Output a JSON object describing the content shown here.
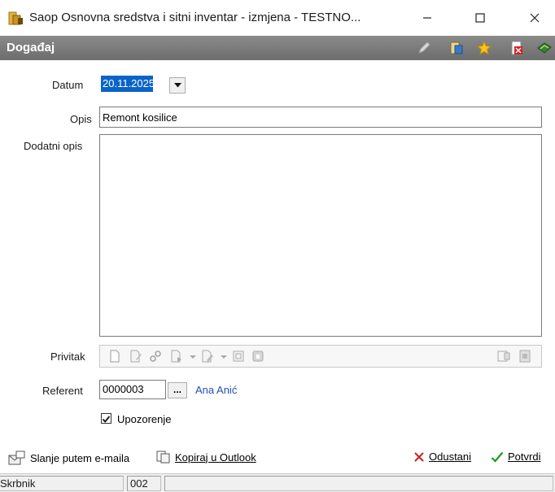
{
  "window": {
    "title": "Saop Osnovna sredstva i sitni inventar - izmjena  - TESTNO...",
    "minimize": "—",
    "maximize": "☐",
    "close": "✕"
  },
  "header": {
    "title": "Događaj",
    "icons": [
      "edit-icon",
      "properties-icon",
      "favorite-star-icon",
      "delete-document-icon",
      "book-icon"
    ]
  },
  "form": {
    "datum_label": "Datum",
    "datum_value": "20.11.2025",
    "opis_label": "Opis",
    "opis_value": "Remont kosilice",
    "dodatni_opis_label": "Dodatni opis",
    "dodatni_opis_value": "",
    "privitak_label": "Privitak",
    "referent_label": "Referent",
    "referent_value": "0000003",
    "referent_button": "...",
    "referent_name": "Ana Anić",
    "upozorenje_label": "Upozorenje",
    "upozorenje_checked": true
  },
  "actions": {
    "email_label": "Slanje putem e-maila",
    "outlook_label": "Kopiraj u Outlook",
    "cancel_label": "Odustani",
    "confirm_label": "Potvrdi"
  },
  "status": {
    "cell1": "Skrbnik",
    "cell2": "002",
    "cell3": ""
  },
  "colors": {
    "header_bg": "#6d6d6d",
    "selection": "#0a64c8",
    "link": "#1f4fb8",
    "cancel_red": "#d11e1e",
    "confirm_green": "#1e9a1e"
  }
}
